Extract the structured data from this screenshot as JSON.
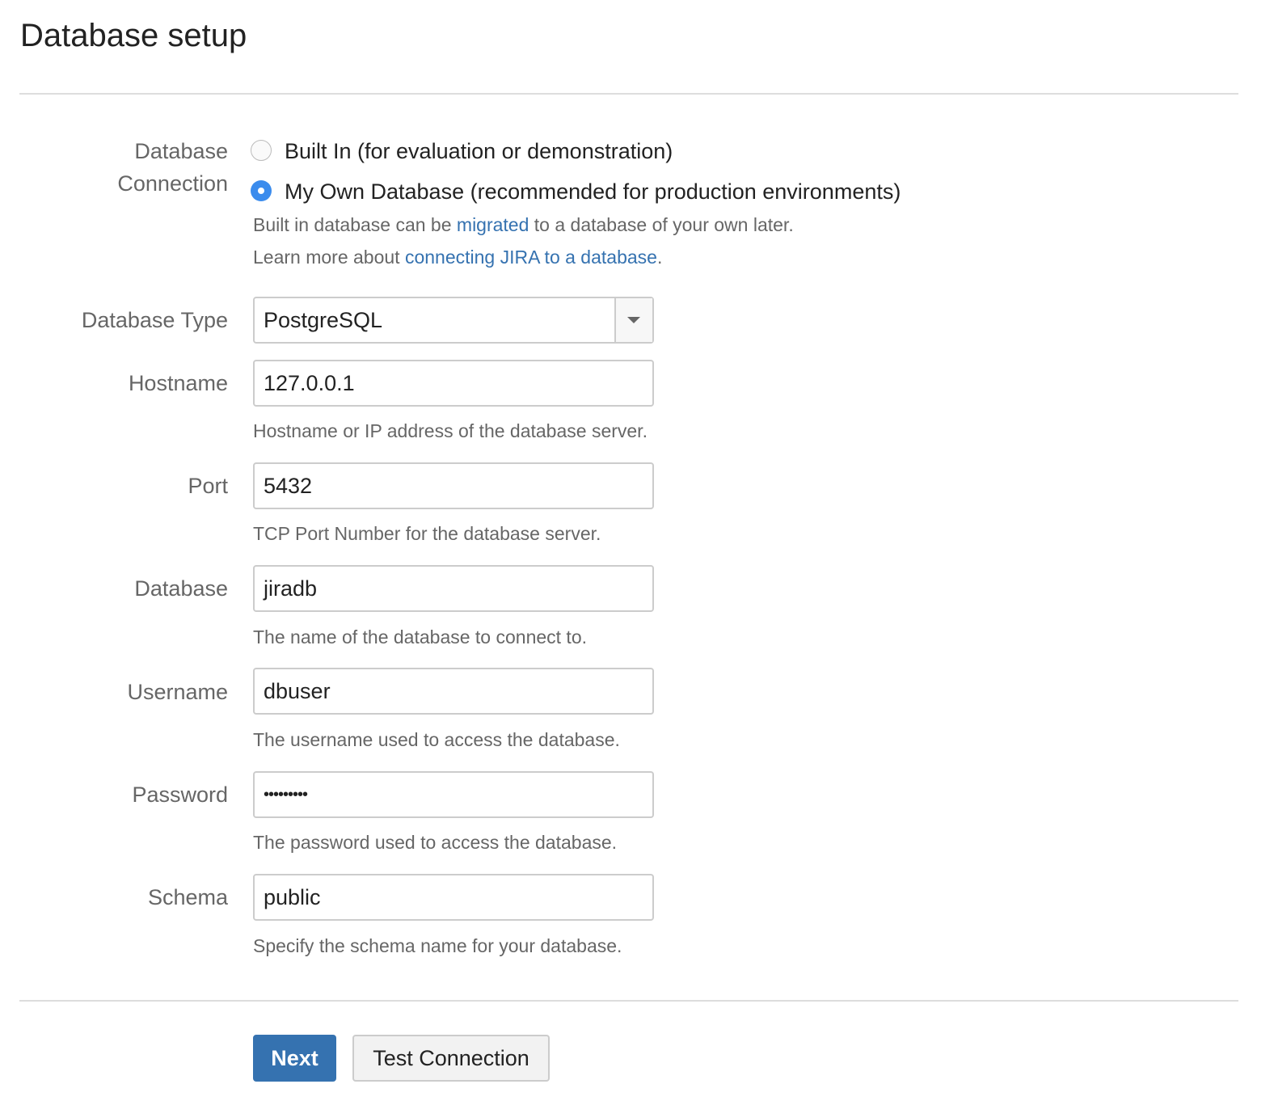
{
  "page_title": "Database setup",
  "connection": {
    "label_line1": "Database",
    "label_line2": "Connection",
    "options": [
      {
        "label": "Built In (for evaluation or demonstration)",
        "selected": false
      },
      {
        "label": "My Own Database (recommended for production environments)",
        "selected": true
      }
    ],
    "help1_pre": "Built in database can be ",
    "help1_link": "migrated",
    "help1_post": " to a database of your own later.",
    "help2_pre": "Learn more about ",
    "help2_link": "connecting JIRA to a database",
    "help2_post": ".",
    "accent_color": "#3b8ced"
  },
  "fields": {
    "db_type": {
      "label": "Database Type",
      "value": "PostgreSQL"
    },
    "hostname": {
      "label": "Hostname",
      "value": "127.0.0.1",
      "help": "Hostname or IP address of the database server."
    },
    "port": {
      "label": "Port",
      "value": "5432",
      "help": "TCP Port Number for the database server."
    },
    "database": {
      "label": "Database",
      "value": "jiradb",
      "help": "The name of the database to connect to."
    },
    "username": {
      "label": "Username",
      "value": "dbuser",
      "help": "The username used to access the database."
    },
    "password": {
      "label": "Password",
      "value": "•••••••••",
      "help": "The password used to access the database."
    },
    "schema": {
      "label": "Schema",
      "value": "public",
      "help": "Specify the schema name for your database."
    }
  },
  "buttons": {
    "next": "Next",
    "test": "Test Connection",
    "primary_color": "#3572b0",
    "link_color": "#3572b0"
  }
}
